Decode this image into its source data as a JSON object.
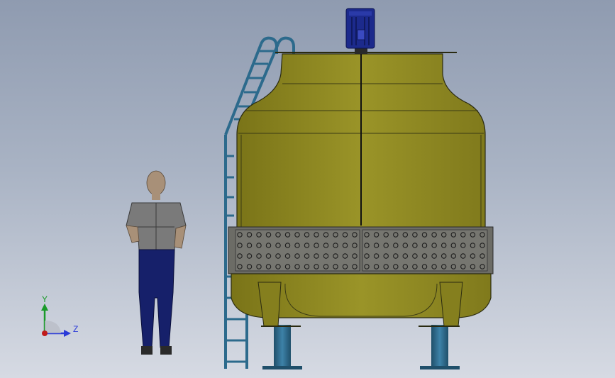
{
  "viewport": {
    "background_top": "#8f9bb0",
    "background_bottom": "#d6dae3"
  },
  "triad": {
    "y_label": "Y",
    "z_label": "Z",
    "y_color": "#1a9a2a",
    "z_color": "#2a3ad8",
    "origin_color": "#c01a1a"
  },
  "model": {
    "tower_color": "#8a8420",
    "tower_shadow": "#6e6a18",
    "louver_color": "#6c6c66",
    "leg_color": "#2f6a8a",
    "ladder_color": "#2c6a8c",
    "motor_color": "#1c2a8c",
    "person_shirt": "#7a7a7a",
    "person_pants": "#16206a",
    "person_skin": "#a89078"
  }
}
